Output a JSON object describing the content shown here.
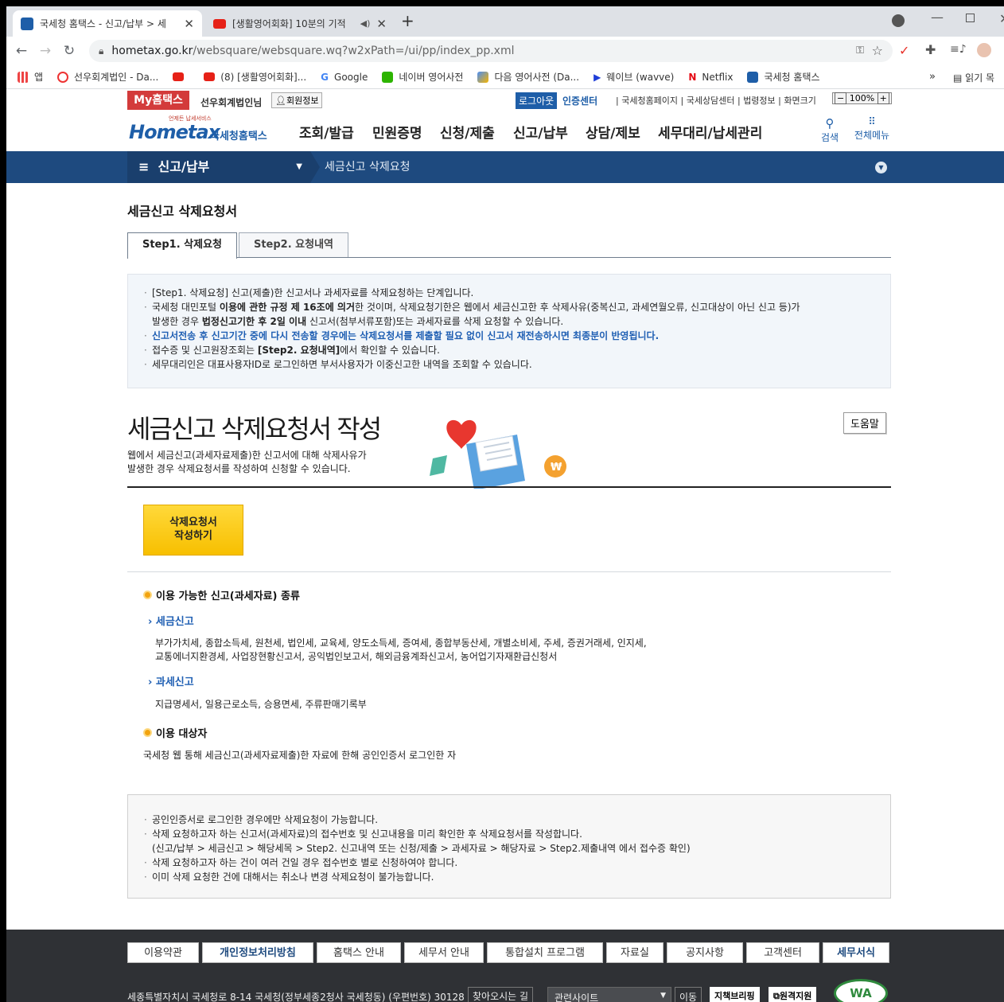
{
  "browser": {
    "tabs": [
      {
        "title": "국세청 홈택스 - 신고/납부 > 세",
        "active": true
      },
      {
        "title": "[생활영어회화] 10분의 기적",
        "active": false
      }
    ],
    "new_tab": "+",
    "url_host": "hometax.go.kr",
    "url_path": "/websquare/websquare.wq?w2xPath=/ui/pp/index_pp.xml",
    "bookmarks": [
      "앱",
      "선우회계법인 - Da...",
      "(8) [생활영어회화]...",
      "Google",
      "네이버 영어사전",
      "다음 영어사전 (Da...",
      "웨이브 (wavve)",
      "Netflix",
      "국세청 홈택스"
    ],
    "bookmarks_more": "»",
    "reading_list": "읽기 목"
  },
  "util": {
    "myhome": "My홈택스",
    "user": "선우회계법인님",
    "member_info": "회원정보",
    "logout": "로그아웃",
    "cert": "인증센터",
    "links": [
      "국세청홈페이지",
      "국세상담센터",
      "법령정보"
    ],
    "zoom_label": "화면크기",
    "zoom_value": "100%"
  },
  "header": {
    "logo_small": "언제든 납세서비스",
    "logo_main": "Hometax",
    "logo_kor": "국세청홈택스",
    "gnb": [
      "조회/발급",
      "민원증명",
      "신청/제출",
      "신고/납부",
      "상담/제보",
      "세무대리/납세관리"
    ],
    "search": "검색",
    "allmenu": "전체메뉴"
  },
  "location": {
    "menu": "신고/납부",
    "current": "세금신고 삭제요청"
  },
  "page": {
    "title": "세금신고 삭제요청서",
    "tab1": "Step1. 삭제요청",
    "tab2": "Step2. 요청내역",
    "info": {
      "l1": "[Step1. 삭제요청] 신고(제출)한 신고서나 과세자료를 삭제요청하는 단계입니다.",
      "l2a": "국세청 대민포털 ",
      "l2b": "이용에 관한 규정 제 16조에 의거",
      "l2c": "한 것이며, 삭제요청기한은 웹에서 세금신고한 후 삭제사유(중복신고, 과세연월오류, 신고대상이 아닌 신고 등)가",
      "l2d": "발생한 경우 ",
      "l2e": "법정신고기한 후 2일 이내",
      "l2f": " 신고서(첨부서류포함)또는 과세자료를 삭제 요청할 수 있습니다.",
      "l3": "신고서전송 후 신고기간 중에 다시 전송할 경우에는 삭제요청서를 제출할 필요 없이 신고서 재전송하시면 최종분이 반영됩니다.",
      "l4a": "접수증 및 신고원장조회는 ",
      "l4b": "[Step2. 요청내역]",
      "l4c": "에서 확인할 수 있습니다.",
      "l5": "세무대리인은 대표사용자ID로 로그인하면 부서사용자가 이중신고한 내역을 조회할 수 있습니다."
    },
    "big_title": "세금신고 삭제요청서 작성",
    "help": "도움말",
    "desc1": "웹에서 세금신고(과세자료제출)한 신고서에 대해 삭제사유가",
    "desc2": "발생한 경우 삭제요청서를 작성하여 신청할 수 있습니다.",
    "write_btn1": "삭제요청서",
    "write_btn2": "작성하기",
    "sec1": "이용 가능한 신고(과세자료) 종류",
    "sub1": "세금신고",
    "sub1_text1": "부가가치세, 종합소득세, 원천세, 법인세, 교육세, 양도소득세, 증여세, 종합부동산세, 개별소비세, 주세, 증권거래세, 인지세,",
    "sub1_text2": "교통에너지환경세, 사업장현황신고서, 공익법인보고서, 해외금융계좌신고서, 농어업기자재환급신청서",
    "sub2": "과세신고",
    "sub2_text": "지급명세서, 일용근로소득, 승용면세, 주류판매기록부",
    "sec2": "이용 대상자",
    "sec2_text": "국세청 웹 통해 세금신고(과세자료제출)한 자료에 한해 공인인증서 로그인한 자",
    "notice": {
      "n1": "공인인증서로 로그인한 경우에만 삭제요청이 가능합니다.",
      "n2": "삭제 요청하고자 하는 신고서(과세자료)의 접수번호 및 신고내용을 미리 확인한 후 삭제요청서를 작성합니다.",
      "n2b": "(신고/납부 > 세금신고 > 해당세목 > Step2. 신고내역 또는 신청/제출 > 과세자료 > 해당자료 > Step2.제출내역 에서 접수증 확인)",
      "n3": "삭제 요청하고자 하는 건이 여러 건일 경우 접수번호 별로 신청하여야 합니다.",
      "n4": "이미 삭제 요청한 건에 대해서는 취소나 변경 삭제요청이 불가능합니다."
    }
  },
  "footer": {
    "links": [
      "이용약관",
      "개인정보처리방침",
      "홈택스 안내",
      "세무서 안내",
      "통합설치 프로그램",
      "자료실",
      "공지사항",
      "고객센터",
      "세무서식"
    ],
    "address": "세종특별자치시 국세청로 8-14 국세청(정부세종2청사 국세청동) (우편번호) 30128",
    "findway": "찾아오시는 길",
    "related": "관련사이트",
    "go": "이동",
    "policy": "지책브리핑",
    "remote": "원격지원",
    "wa": "WA"
  },
  "colors": {
    "accent_red": "#d33b3b",
    "nav_blue": "#1e4a7f",
    "text_blue": "#1f5fb3",
    "button_yellow": "#f7bf00"
  }
}
